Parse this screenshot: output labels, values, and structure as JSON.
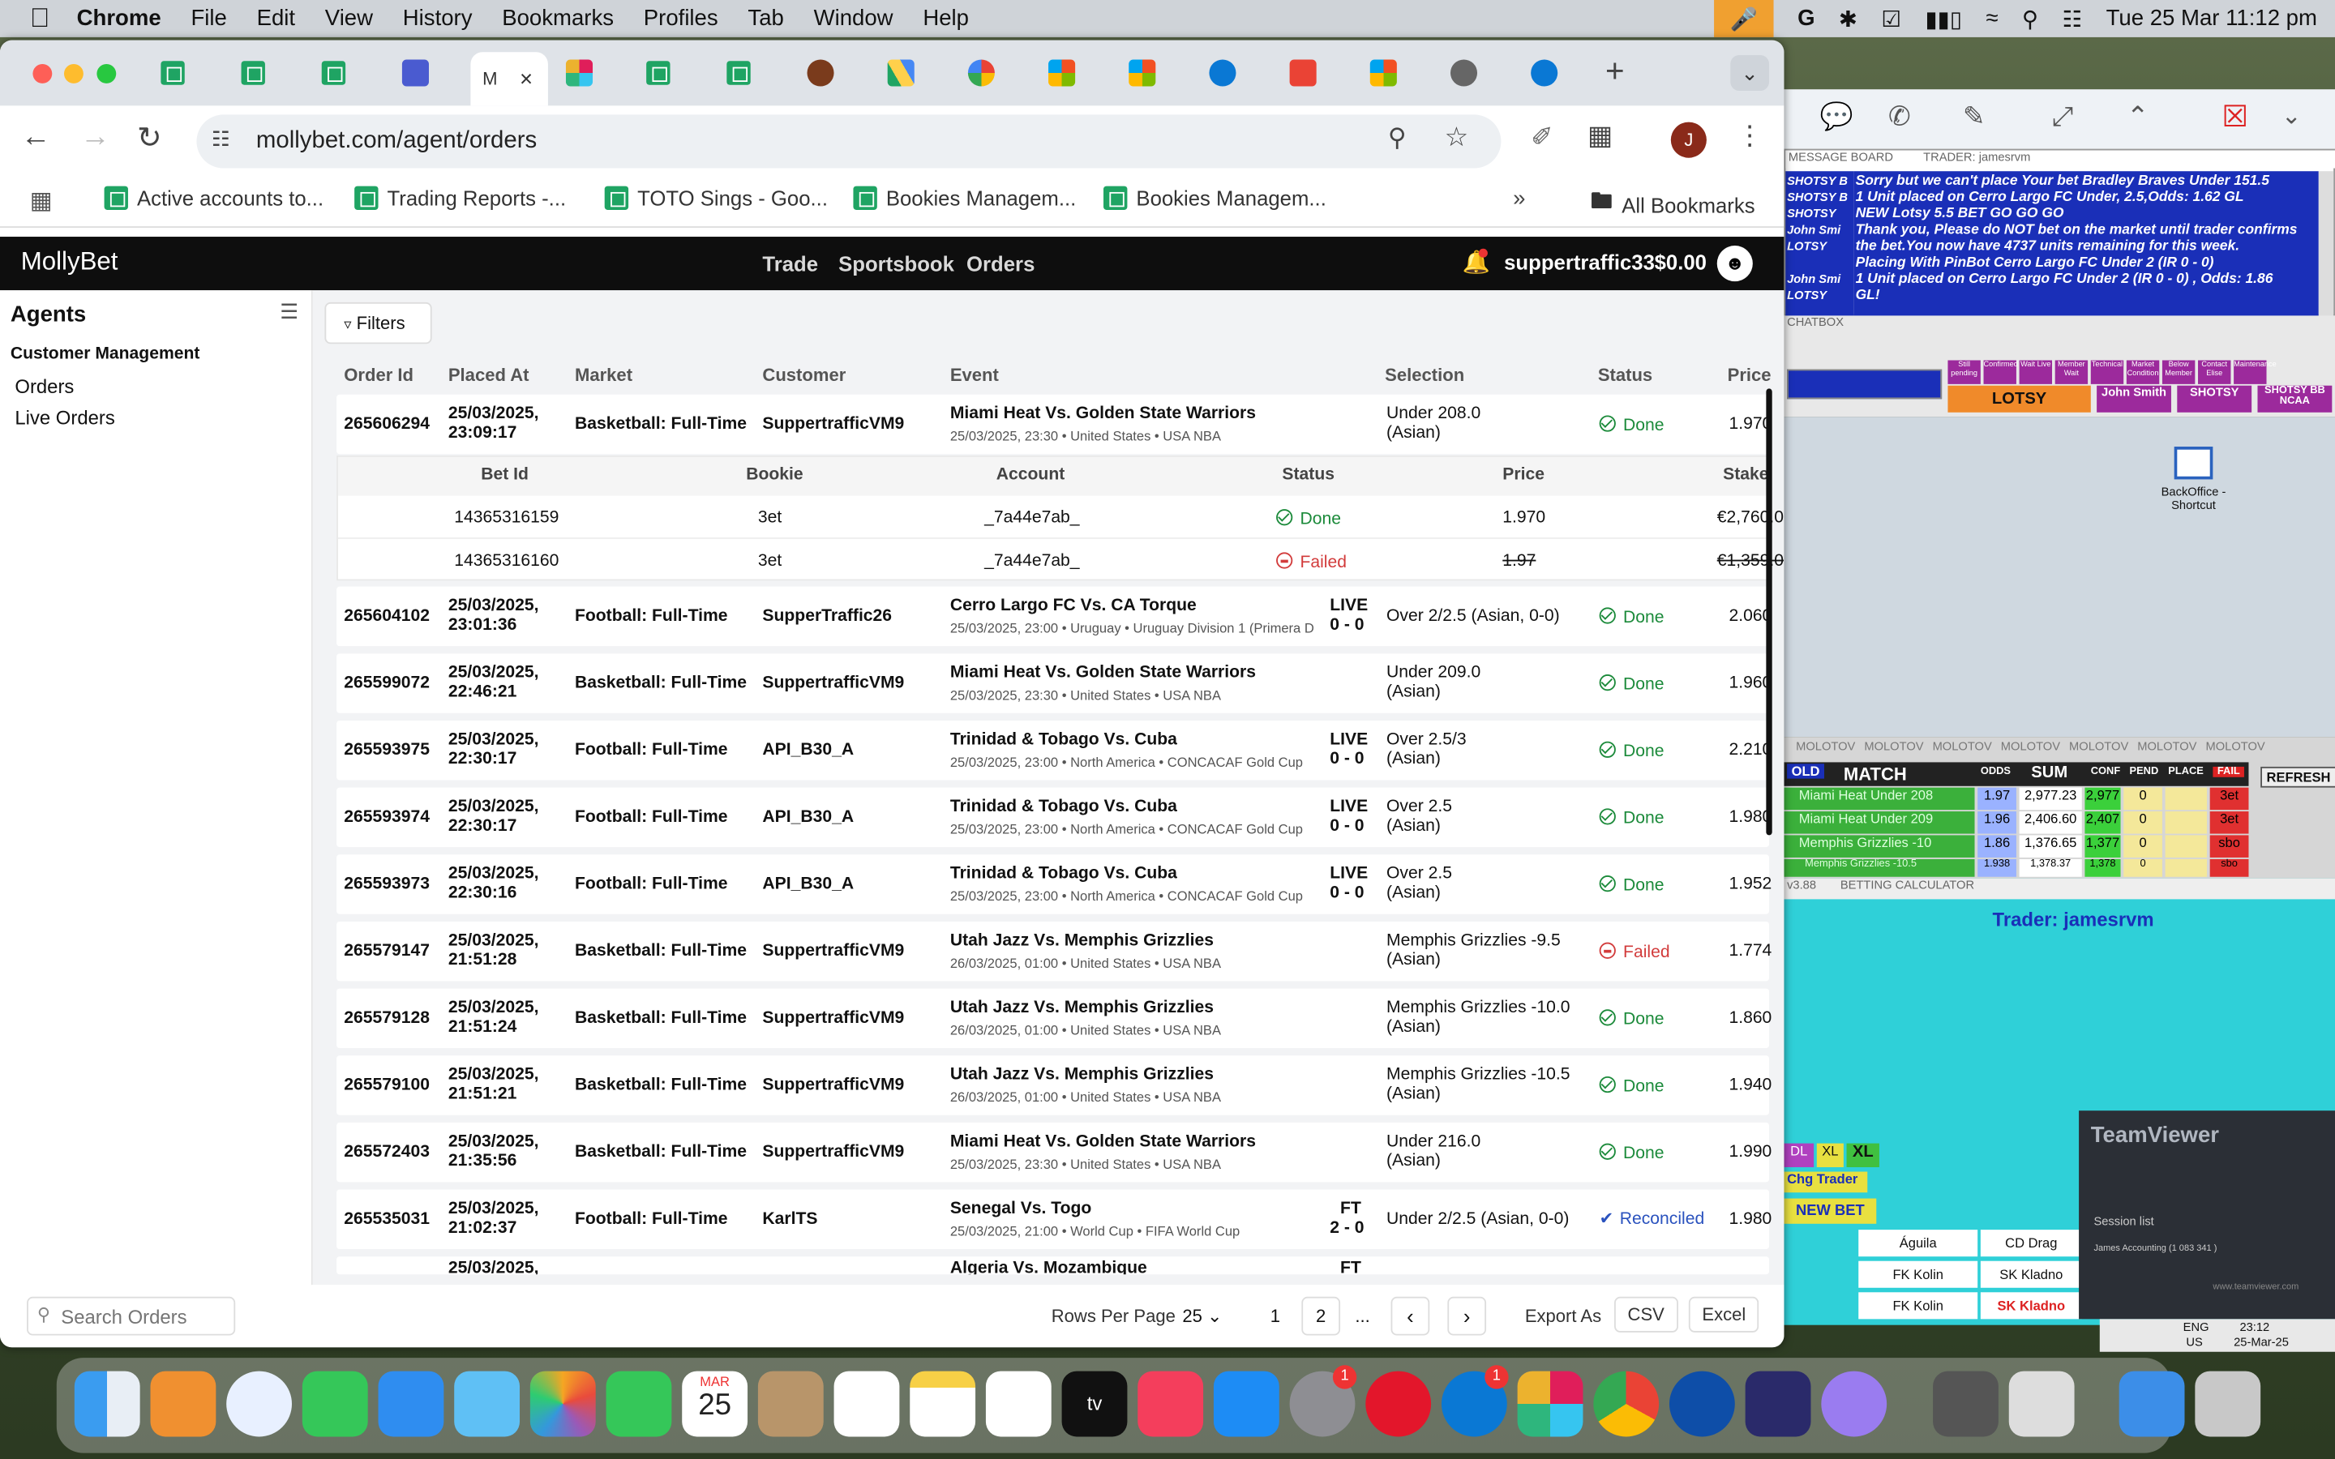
{
  "menubar": {
    "app": "Chrome",
    "items": [
      "File",
      "Edit",
      "View",
      "History",
      "Bookmarks",
      "Profiles",
      "Tab",
      "Window",
      "Help"
    ],
    "datetime": "Tue 25 Mar  11:12 pm"
  },
  "browser": {
    "url": "mollybet.com/agent/orders",
    "profile_initial": "J",
    "new_tab": "+"
  },
  "bookmarks": {
    "items": [
      "Active accounts to...",
      "Trading Reports -...",
      "TOTO Sings - Goo...",
      "Bookies Managem...",
      "Bookies Managem..."
    ],
    "all": "All Bookmarks"
  },
  "app": {
    "logo": "MollyBet",
    "nav": [
      "Trade",
      "Sportsbook",
      "Orders"
    ],
    "username": "suppertraffic33",
    "balance": "$0.00"
  },
  "sidebar": {
    "title": "Agents",
    "section": "Customer Management",
    "items": [
      "Orders",
      "Live Orders"
    ]
  },
  "main": {
    "filters": "Filters",
    "columns": [
      "Order Id",
      "Placed At",
      "Market",
      "Customer",
      "Event",
      "Selection",
      "Status",
      "Price"
    ],
    "sub_columns": [
      "Bet Id",
      "Bookie",
      "Account",
      "Status",
      "Price",
      "Stake"
    ],
    "sub_rows": [
      {
        "bet_id": "14365316159",
        "bookie": "3et",
        "account": "_7a44e7ab_",
        "status": "Done",
        "price": "1.970",
        "stake": "€2,760.0"
      },
      {
        "bet_id": "14365316160",
        "bookie": "3et",
        "account": "_7a44e7ab_",
        "status": "Failed",
        "price": "1.97",
        "stake": "€1,359.0"
      }
    ],
    "orders": [
      {
        "id": "265606294",
        "placed": "25/03/2025,",
        "time": "23:09:17",
        "market": "Basketball: Full-Time",
        "customer": "SuppertrafficVM9",
        "event": "Miami Heat Vs. Golden State Warriors",
        "event_sub": "25/03/2025, 23:30 • United States • USA NBA",
        "live": "",
        "score": "",
        "sel1": "Under 208.0",
        "sel2": "(Asian)",
        "status": "Done",
        "price": "1.970"
      },
      {
        "id": "265604102",
        "placed": "25/03/2025,",
        "time": "23:01:36",
        "market": "Football: Full-Time",
        "customer": "SupperTraffic26",
        "event": "Cerro Largo FC Vs. CA Torque",
        "event_sub": "25/03/2025, 23:00 • Uruguay • Uruguay Division 1 (Primera D",
        "live": "LIVE",
        "score": "0 - 0",
        "sel1": "Over 2/2.5 (Asian, 0-0)",
        "sel2": "",
        "status": "Done",
        "price": "2.060"
      },
      {
        "id": "265599072",
        "placed": "25/03/2025,",
        "time": "22:46:21",
        "market": "Basketball: Full-Time",
        "customer": "SuppertrafficVM9",
        "event": "Miami Heat Vs. Golden State Warriors",
        "event_sub": "25/03/2025, 23:30 • United States • USA NBA",
        "live": "",
        "score": "",
        "sel1": "Under 209.0",
        "sel2": "(Asian)",
        "status": "Done",
        "price": "1.960"
      },
      {
        "id": "265593975",
        "placed": "25/03/2025,",
        "time": "22:30:17",
        "market": "Football: Full-Time",
        "customer": "API_B30_A",
        "event": "Trinidad & Tobago Vs. Cuba",
        "event_sub": "25/03/2025, 23:00 • North America • CONCACAF Gold Cup",
        "live": "LIVE",
        "score": "0 - 0",
        "sel1": "Over 2.5/3",
        "sel2": "(Asian)",
        "status": "Done",
        "price": "2.210"
      },
      {
        "id": "265593974",
        "placed": "25/03/2025,",
        "time": "22:30:17",
        "market": "Football: Full-Time",
        "customer": "API_B30_A",
        "event": "Trinidad & Tobago Vs. Cuba",
        "event_sub": "25/03/2025, 23:00 • North America • CONCACAF Gold Cup",
        "live": "LIVE",
        "score": "0 - 0",
        "sel1": "Over 2.5",
        "sel2": "(Asian)",
        "status": "Done",
        "price": "1.980"
      },
      {
        "id": "265593973",
        "placed": "25/03/2025,",
        "time": "22:30:16",
        "market": "Football: Full-Time",
        "customer": "API_B30_A",
        "event": "Trinidad & Tobago Vs. Cuba",
        "event_sub": "25/03/2025, 23:00 • North America • CONCACAF Gold Cup",
        "live": "LIVE",
        "score": "0 - 0",
        "sel1": "Over 2.5",
        "sel2": "(Asian)",
        "status": "Done",
        "price": "1.952"
      },
      {
        "id": "265579147",
        "placed": "25/03/2025,",
        "time": "21:51:28",
        "market": "Basketball: Full-Time",
        "customer": "SuppertrafficVM9",
        "event": "Utah Jazz Vs. Memphis Grizzlies",
        "event_sub": "26/03/2025, 01:00 • United States • USA NBA",
        "live": "",
        "score": "",
        "sel1": "Memphis Grizzlies -9.5",
        "sel2": "(Asian)",
        "status": "Failed",
        "price": "1.774"
      },
      {
        "id": "265579128",
        "placed": "25/03/2025,",
        "time": "21:51:24",
        "market": "Basketball: Full-Time",
        "customer": "SuppertrafficVM9",
        "event": "Utah Jazz Vs. Memphis Grizzlies",
        "event_sub": "26/03/2025, 01:00 • United States • USA NBA",
        "live": "",
        "score": "",
        "sel1": "Memphis Grizzlies -10.0",
        "sel2": "(Asian)",
        "status": "Done",
        "price": "1.860"
      },
      {
        "id": "265579100",
        "placed": "25/03/2025,",
        "time": "21:51:21",
        "market": "Basketball: Full-Time",
        "customer": "SuppertrafficVM9",
        "event": "Utah Jazz Vs. Memphis Grizzlies",
        "event_sub": "26/03/2025, 01:00 • United States • USA NBA",
        "live": "",
        "score": "",
        "sel1": "Memphis Grizzlies -10.5",
        "sel2": "(Asian)",
        "status": "Done",
        "price": "1.940"
      },
      {
        "id": "265572403",
        "placed": "25/03/2025,",
        "time": "21:35:56",
        "market": "Basketball: Full-Time",
        "customer": "SuppertrafficVM9",
        "event": "Miami Heat Vs. Golden State Warriors",
        "event_sub": "25/03/2025, 23:30 • United States • USA NBA",
        "live": "",
        "score": "",
        "sel1": "Under 216.0",
        "sel2": "(Asian)",
        "status": "Done",
        "price": "1.990"
      },
      {
        "id": "265535031",
        "placed": "25/03/2025,",
        "time": "21:02:37",
        "market": "Football: Full-Time",
        "customer": "KarlTS",
        "event": "Senegal Vs. Togo",
        "event_sub": "25/03/2025, 21:00 • World Cup • FIFA World Cup",
        "live": "FT",
        "score": "2 - 0",
        "sel1": "Under 2/2.5 (Asian, 0-0)",
        "sel2": "",
        "status": "Reconciled",
        "price": "1.980"
      }
    ],
    "partial_row": {
      "placed": "25/03/2025,",
      "event": "Algeria Vs. Mozambique",
      "live": "FT"
    }
  },
  "footer": {
    "search_placeholder": "Search Orders",
    "rows_per_page_label": "Rows Per Page",
    "rows_per_page": "25",
    "pages": [
      "1",
      "2",
      "..."
    ],
    "export_as": "Export As",
    "csv": "CSV",
    "excel": "Excel"
  },
  "message_board": {
    "title": "MESSAGE BOARD",
    "trader": "TRADER: jamesrvm",
    "senders": [
      "SHOTSY B",
      "SHOTSY B",
      "SHOTSY",
      "John Smi",
      "LOTSY",
      "",
      "John Smi",
      "LOTSY"
    ],
    "lines": [
      "Sorry but we can't place Your bet Bradley Braves Under 151.5",
      "1 Unit placed on Cerro Largo FC Under, 2.5,Odds: 1.62 GL",
      "NEW Lotsy 5.5 BET GO GO GO",
      "Thank you, Please do NOT bet on the market until trader confirms",
      "the bet.You now have 4737 units remaining for this week.",
      "Placing With PinBot Cerro Largo FC Under 2 (IR 0 - 0)",
      "1 Unit placed on Cerro Largo FC Under 2 (IR 0 - 0) , Odds: 1.86",
      "GL!"
    ]
  },
  "chatbox": {
    "title": "CHATBOX",
    "buttons": [
      "Still pending",
      "Confirmed",
      "Wait Live",
      "Member Wait",
      "Technical",
      "Market Condition",
      "Below Member",
      "Contact Elise",
      "Maintenance"
    ],
    "names": [
      "LOTSY",
      "John Smith",
      "SHOTSY",
      "SHOTSY BB NCAA"
    ]
  },
  "desktop": {
    "shortcut": "BackOffice - Shortcut"
  },
  "molotov": {
    "tabs": [
      "MOLOTOV",
      "MOLOTOV",
      "MOLOTOV",
      "MOLOTOV",
      "MOLOTOV",
      "MOLOTOV",
      "MOLOTOV"
    ],
    "old": "OLD",
    "headers": [
      "MATCH",
      "ODDS",
      "SUM",
      "CONF",
      "PEND",
      "PLACE",
      "FAIL"
    ],
    "refresh": "REFRESH",
    "rows": [
      {
        "match": "Miami Heat Under 208",
        "odds": "1.97",
        "sum": "2,977.23",
        "conf": "2,977",
        "pend": "0",
        "fail": "3et"
      },
      {
        "match": "Miami Heat Under 209",
        "odds": "1.96",
        "sum": "2,406.60",
        "conf": "2,407",
        "pend": "0",
        "fail": "3et"
      },
      {
        "match": "Memphis Grizzlies -10",
        "odds": "1.86",
        "sum": "1,376.65",
        "conf": "1,377",
        "pend": "0",
        "fail": "sbo"
      },
      {
        "match": "Memphis Grizzlies -10.5",
        "odds": "1.938",
        "sum": "1,378.37",
        "conf": "1,378",
        "pend": "0",
        "fail": "sbo"
      }
    ]
  },
  "calculator": {
    "version": "v3.88",
    "title": "BETTING CALCULATOR",
    "trader": "Trader: jamesrvm",
    "dl": "DL",
    "xl1": "XL",
    "xl2": "XL",
    "chg_trader": "Chg Trader",
    "new_bet": "NEW BET",
    "teams": [
      [
        "Águila",
        "CD Drag"
      ],
      [
        "FK Kolin",
        "SK Kladno"
      ],
      [
        "FK Kolin",
        "SK Kladno"
      ]
    ]
  },
  "teamviewer": {
    "title": "TeamViewer",
    "session_list": "Session list",
    "session": "James Accounting (1 083 341 )",
    "url": "www.teamviewer.com"
  },
  "taskbar": {
    "lang": "ENG",
    "region": "US",
    "time": "23:12",
    "date": "25-Mar-25"
  },
  "dock": {
    "calendar_month": "MAR",
    "calendar_day": "25",
    "badge1": "1",
    "badge2": "1"
  },
  "colors": {
    "done": "#1b8a3a",
    "failed": "#d23b3b",
    "reconciled": "#2a52be",
    "appbar": "#0e0e0e",
    "calc_bg": "#2fd0d8"
  }
}
